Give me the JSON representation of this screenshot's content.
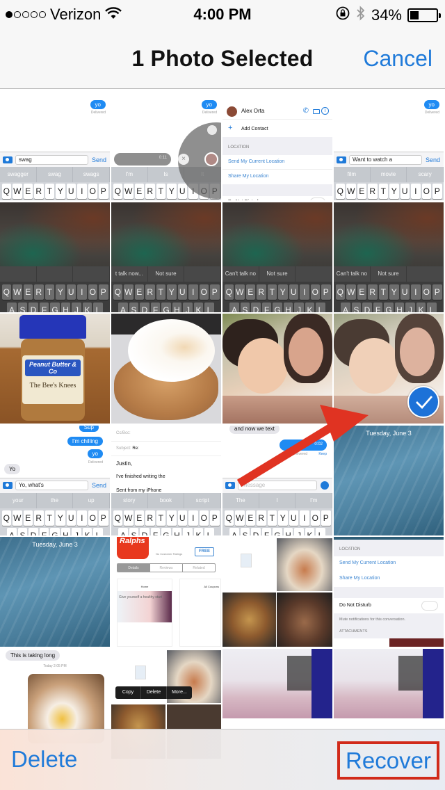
{
  "status_bar": {
    "carrier": "Verizon",
    "signal_bars_filled": 1,
    "signal_bars_total": 5,
    "time": "4:00 PM",
    "battery_percent": "34%",
    "battery_level": 0.34,
    "icons": [
      "wifi-icon",
      "rotation-lock-icon",
      "bluetooth-icon",
      "battery-icon"
    ]
  },
  "nav": {
    "title": "1 Photo Selected",
    "cancel_label": "Cancel"
  },
  "colors": {
    "accent": "#1f7ad9",
    "highlight_box": "#d12a1a",
    "arrow": "#e03322",
    "check_badge": "#1d72d8"
  },
  "photos": [
    {
      "kind": "imessage-keyboard",
      "bubble": "yo",
      "status": "Delivered",
      "input": "swag",
      "send": "Send",
      "suggestions": [
        "swagger",
        "swag",
        "swags"
      ]
    },
    {
      "kind": "imessage-audio",
      "bubble": "yo",
      "status": "Delivered",
      "audio_time": "0:11",
      "suggestions": [
        "I'm",
        "Is",
        "It"
      ]
    },
    {
      "kind": "contact-details",
      "contact_name": "Alex Orta",
      "add_contact": "Add Contact",
      "section": "LOCATION",
      "links": [
        "Send My Current Location",
        "Share My Location"
      ],
      "dnd": "Do Not Disturb"
    },
    {
      "kind": "imessage-keyboard",
      "bubble": "yo",
      "status": "Delivered",
      "input": "Want to watch a",
      "send": "Send",
      "suggestions": [
        "film",
        "movie",
        "scary"
      ]
    },
    {
      "kind": "blurred-dark-keyboard",
      "quicktype": [
        "",
        "",
        ""
      ]
    },
    {
      "kind": "blurred-dark-keyboard",
      "quicktype": [
        "t talk now...",
        "Not sure",
        ""
      ]
    },
    {
      "kind": "blurred-dark-keyboard",
      "quicktype": [
        "Can't talk no",
        "Not sure",
        ""
      ]
    },
    {
      "kind": "blurred-dark-keyboard",
      "quicktype": [
        "Can't talk no",
        "Not sure",
        ""
      ]
    },
    {
      "kind": "photo",
      "subject": "Peanut Butter & Co jar",
      "label_line1": "Peanut Butter & Co",
      "label_line2": "The Bee's Knees"
    },
    {
      "kind": "photo",
      "subject": "fried egg on pancakes"
    },
    {
      "kind": "photo",
      "subject": "baby and woman"
    },
    {
      "kind": "photo",
      "subject": "baby and woman",
      "selected": true
    },
    {
      "kind": "imessage-conversation",
      "bubbles_sent": [
        "Sup",
        "I'm chilling",
        "yo"
      ],
      "status": "Delivered",
      "bubble_received": "Yo",
      "input": "Yo, what's",
      "send": "Send",
      "suggestions": [
        "your",
        "the",
        "up"
      ]
    },
    {
      "kind": "mail-compose",
      "cc_label": "Cc/Bcc:",
      "subject_label": "Subject:",
      "subject_value": "Re:",
      "greeting": "Justin,",
      "body": "I've finished writing the",
      "signature": "Sent from my iPhone",
      "suggestions": [
        "story",
        "book",
        "script"
      ]
    },
    {
      "kind": "imessage-audio-sent",
      "bubble_received": "and now we text",
      "audio_time": "0:02",
      "status": "Delivered",
      "keep": "Keep",
      "placeholder": "iMessage",
      "suggestions": [
        "The",
        "I",
        "I'm"
      ]
    },
    {
      "kind": "lock-screen",
      "date": "Tuesday, June 3"
    },
    {
      "kind": "lock-screen",
      "date": "Tuesday, June 3"
    },
    {
      "kind": "app-store",
      "app": "Ralphs",
      "ratings": "No Customer Ratings",
      "price": "FREE",
      "tabs": [
        "Details",
        "Reviews",
        "Related"
      ],
      "screens": [
        "Home",
        "All Coupons"
      ],
      "promo": "Give yourself a healthy start"
    },
    {
      "kind": "message-attachments"
    },
    {
      "kind": "contact-details-lower",
      "section": "LOCATION",
      "links": [
        "Send My Current Location",
        "Share My Location"
      ],
      "dnd": "Do Not Disturb",
      "mute_note": "Mute notifications for this conversation.",
      "attachments": "ATTACHMENTS"
    },
    {
      "kind": "imessage-photo",
      "bubble_received": "This is taking long",
      "timestamp": "Today 2:05 PM"
    },
    {
      "kind": "message-attachments-menu",
      "menu": [
        "Copy",
        "Delete",
        "More..."
      ]
    },
    {
      "kind": "photo",
      "subject": "concert stage"
    },
    {
      "kind": "photo",
      "subject": "concert stage"
    }
  ],
  "keyboard_rows": {
    "row1": [
      "Q",
      "W",
      "E",
      "R",
      "T",
      "Y",
      "U",
      "I",
      "O",
      "P"
    ],
    "row2": [
      "A",
      "S",
      "D",
      "F",
      "G",
      "H",
      "J",
      "K",
      "L"
    ]
  },
  "toolbar": {
    "delete_label": "Delete",
    "recover_label": "Recover"
  }
}
